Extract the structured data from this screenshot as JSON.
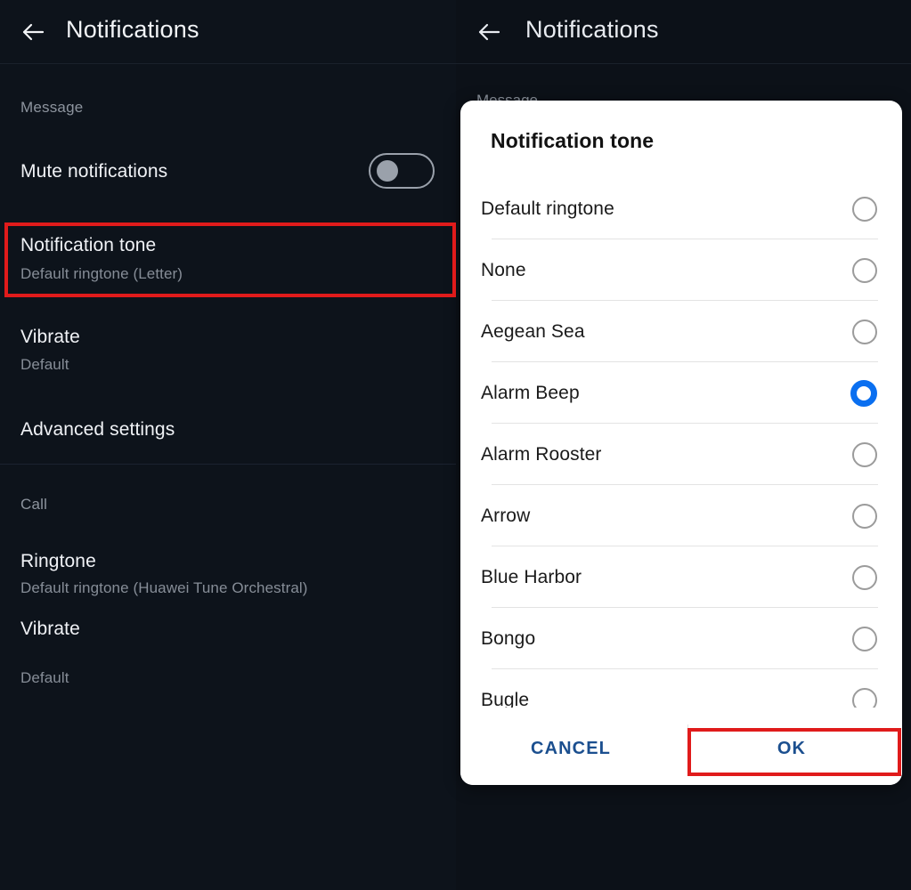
{
  "left_panel": {
    "appbar": {
      "title": "Notifications",
      "back_icon": "arrow-left-icon"
    },
    "sections": [
      {
        "label": "Message",
        "rows": [
          {
            "title": "Mute notifications",
            "subtitle": "",
            "control": "toggle",
            "toggle_on": false
          },
          {
            "title": "Notification tone",
            "subtitle": "Default ringtone (Letter)",
            "highlighted": true
          },
          {
            "title": "Vibrate",
            "subtitle": "Default"
          },
          {
            "title": "Advanced settings",
            "subtitle": ""
          }
        ]
      },
      {
        "label": "Call",
        "rows": [
          {
            "title": "Ringtone",
            "subtitle": "Default ringtone (Huawei Tune Orchestral)"
          },
          {
            "title": "Vibrate",
            "subtitle": "Default"
          }
        ]
      }
    ]
  },
  "right_panel": {
    "appbar": {
      "title": "Notifications",
      "back_icon": "arrow-left-icon"
    },
    "behind_section_label": "Message",
    "dialog": {
      "title": "Notification tone",
      "options": [
        {
          "label": "Default ringtone",
          "selected": false
        },
        {
          "label": "None",
          "selected": false
        },
        {
          "label": "Aegean Sea",
          "selected": false
        },
        {
          "label": "Alarm Beep",
          "selected": true
        },
        {
          "label": "Alarm Rooster",
          "selected": false
        },
        {
          "label": "Arrow",
          "selected": false
        },
        {
          "label": "Blue Harbor",
          "selected": false
        },
        {
          "label": "Bongo",
          "selected": false
        },
        {
          "label": "Bugle",
          "selected": false
        }
      ],
      "cancel_label": "CANCEL",
      "ok_label": "OK"
    }
  },
  "annotations": {
    "highlight_color": "#e01b1b",
    "boxes": [
      {
        "name": "notification-tone-row-highlight"
      },
      {
        "name": "ok-button-highlight"
      }
    ]
  },
  "colors": {
    "background": "#0d131b",
    "accent_blue": "#0a6ff0",
    "action_text": "#1b4f8f",
    "highlight_red": "#e01b1b"
  }
}
